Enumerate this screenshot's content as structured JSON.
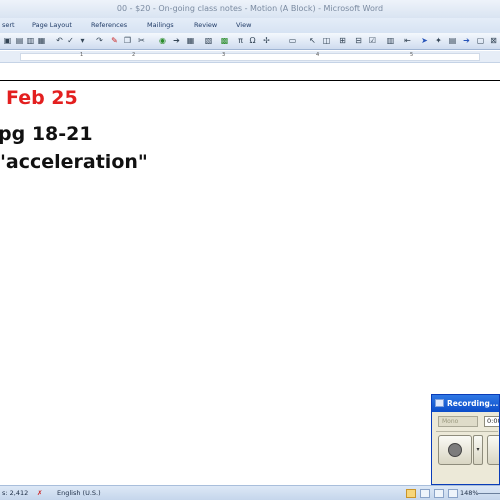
{
  "window": {
    "title": "00 - $20 - On-going class notes - Motion (A Block) - Microsoft Word"
  },
  "ribbon": {
    "tabs": [
      {
        "label": "sert"
      },
      {
        "label": "Page Layout"
      },
      {
        "label": "References"
      },
      {
        "label": "Mailings"
      },
      {
        "label": "Review"
      },
      {
        "label": "View"
      }
    ]
  },
  "document": {
    "lines": [
      {
        "text": "Feb 25",
        "color": "#e31f1f"
      },
      {
        "text": "pg 18-21",
        "color": "#111111"
      },
      {
        "text": "\"acceleration\"",
        "color": "#111111"
      }
    ]
  },
  "statusbar": {
    "words": "s: 2,412",
    "language": "English (U.S.)",
    "zoom": "148%"
  },
  "recorder": {
    "title": "Recording...",
    "source": "Mono",
    "time": "0:00"
  }
}
